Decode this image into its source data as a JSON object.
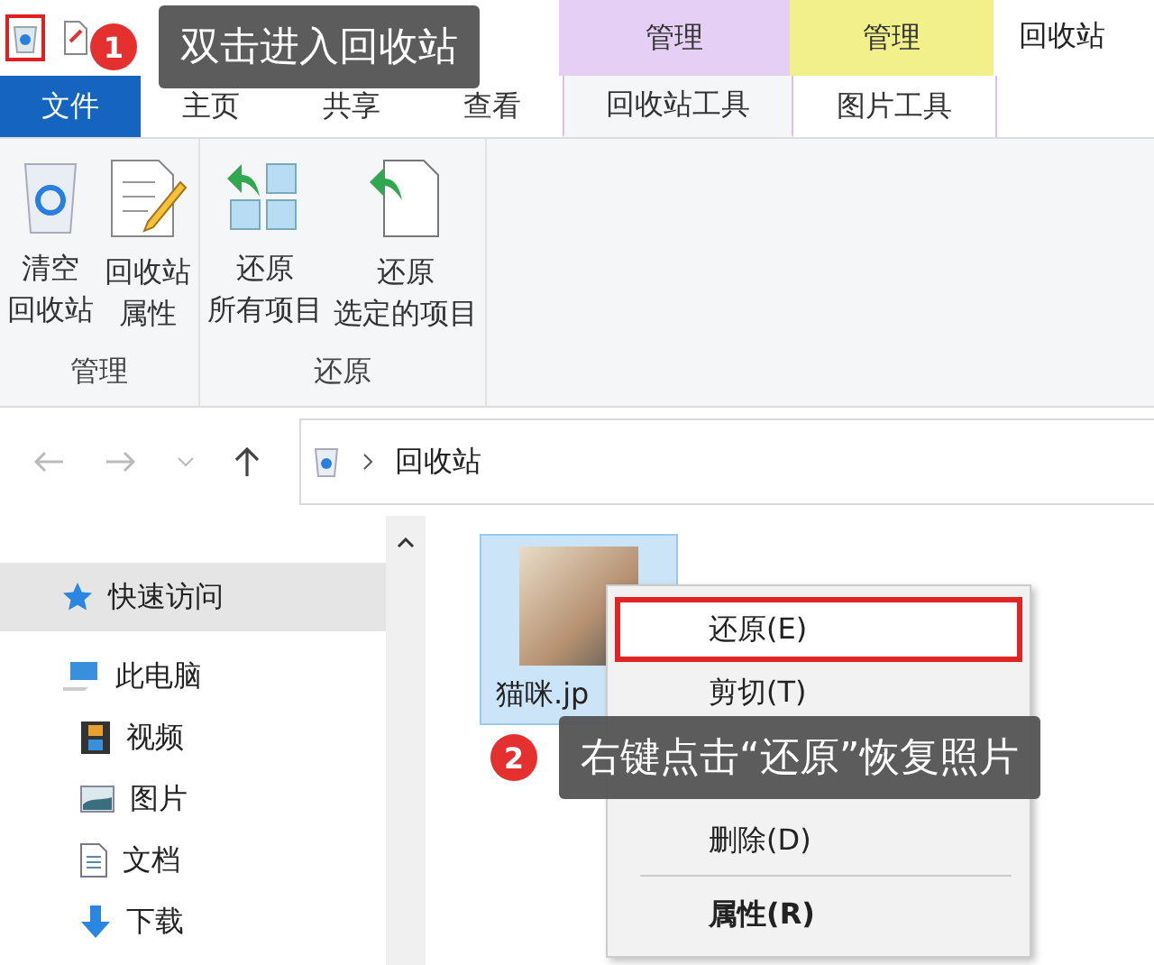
{
  "window": {
    "title": "回收站"
  },
  "context_tabs": [
    {
      "label": "管理",
      "color": "#e6cff5"
    },
    {
      "label": "管理",
      "color": "#f2f08a"
    }
  ],
  "tabs": [
    {
      "label": "文件",
      "kind": "file",
      "selected": false
    },
    {
      "label": "主页",
      "kind": "tab",
      "selected": false
    },
    {
      "label": "共享",
      "kind": "tab",
      "selected": false
    },
    {
      "label": "查看",
      "kind": "tab",
      "selected": false
    },
    {
      "label": "回收站工具",
      "kind": "context",
      "selected": true
    },
    {
      "label": "图片工具",
      "kind": "context",
      "selected": false
    }
  ],
  "ribbon": {
    "groups": [
      {
        "label": "管理",
        "buttons": [
          {
            "lines": [
              "清空",
              "回收站"
            ],
            "kind": "empty-bin"
          },
          {
            "lines": [
              "回收站",
              "属性"
            ],
            "kind": "properties"
          }
        ]
      },
      {
        "label": "还原",
        "buttons": [
          {
            "lines": [
              "还原",
              "所有项目"
            ],
            "kind": "restore-all"
          },
          {
            "lines": [
              "还原",
              "选定的项目"
            ],
            "kind": "restore-selected"
          }
        ]
      }
    ]
  },
  "address_bar": {
    "path": "回收站"
  },
  "nav_pane": {
    "items": [
      {
        "label": "快速访问",
        "kind": "star",
        "selected": true
      },
      {
        "label": "此电脑",
        "kind": "pc",
        "selected": false
      },
      {
        "label": "视频",
        "kind": "video",
        "selected": false
      },
      {
        "label": "图片",
        "kind": "pictures",
        "selected": false
      },
      {
        "label": "文档",
        "kind": "documents",
        "selected": false
      },
      {
        "label": "下载",
        "kind": "download",
        "selected": false
      }
    ]
  },
  "files": [
    {
      "name": "猫咪.jp",
      "selected": true
    }
  ],
  "context_menu": {
    "items": [
      {
        "label": "还原(E)",
        "kind": "item",
        "bold": false,
        "highlighted": true
      },
      {
        "label": "剪切(T)",
        "kind": "item",
        "bold": false,
        "highlighted": false
      },
      {
        "label": "删除(D)",
        "kind": "item",
        "bold": false,
        "highlighted": false
      },
      {
        "kind": "separator"
      },
      {
        "label": "属性(R)",
        "kind": "item",
        "bold": true,
        "highlighted": false
      }
    ]
  },
  "callouts": [
    {
      "number": "1",
      "text": "双击进入回收站"
    },
    {
      "number": "2",
      "text": "右键点击“还原”恢复照片"
    }
  ]
}
